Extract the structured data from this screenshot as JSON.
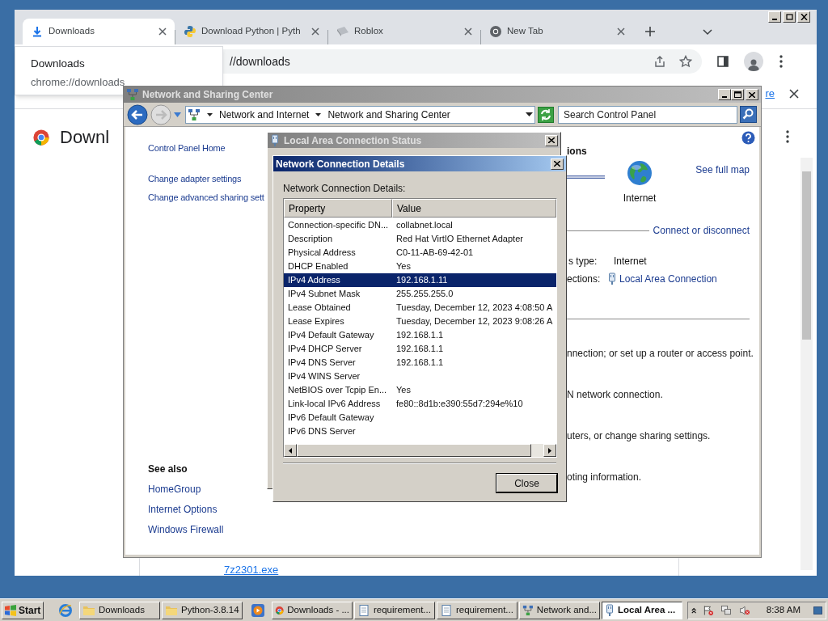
{
  "browser": {
    "tabs": [
      {
        "kind": "download",
        "title": "Downloads",
        "selected": true
      },
      {
        "kind": "python",
        "title": "Download Python | Pyth",
        "selected": false
      },
      {
        "kind": "roblox",
        "title": "Roblox",
        "selected": false
      },
      {
        "kind": "chrome",
        "title": "New Tab",
        "selected": false
      }
    ],
    "address": "//downloads",
    "tooltip": {
      "title": "Downloads",
      "url": "chrome://downloads"
    },
    "infobar": {
      "link": "re"
    },
    "page": {
      "heading": "Downl",
      "file_link": "7z2301.exe"
    }
  },
  "network_center": {
    "title": "Network and Sharing Center",
    "breadcrumb": [
      "Network and Internet",
      "Network and Sharing Center"
    ],
    "search": {
      "placeholder": "Search Control Panel"
    },
    "sidebar": {
      "links": [
        "Control Panel Home",
        "Change adapter settings",
        "Change advanced sharing sett"
      ],
      "see_also_heading": "See also",
      "see_also": [
        "HomeGroup",
        "Internet Options",
        "Windows Firewall"
      ]
    },
    "content": {
      "heading": "ions",
      "map_link": "See full map",
      "internet_label": "Internet",
      "connect_link": "Connect or disconnect",
      "access_type_label": "s type:",
      "access_type": "Internet",
      "connections_label": "ections:",
      "connection_link": "Local Area Connection",
      "tasks": [
        "nnection; or set up a router or access point.",
        "N network connection.",
        "uters, or change sharing settings.",
        "oting information."
      ]
    }
  },
  "status_window": {
    "title": "Local Area Connection Status"
  },
  "details_dialog": {
    "title": "Network Connection Details",
    "label": "Network Connection Details:",
    "columns": [
      "Property",
      "Value"
    ],
    "rows": [
      {
        "property": "Connection-specific DN...",
        "value": "collabnet.local",
        "selected": false
      },
      {
        "property": "Description",
        "value": "Red Hat VirtIO Ethernet Adapter",
        "selected": false
      },
      {
        "property": "Physical Address",
        "value": "C0-11-AB-69-42-01",
        "selected": false
      },
      {
        "property": "DHCP Enabled",
        "value": "Yes",
        "selected": false
      },
      {
        "property": "IPv4 Address",
        "value": "192.168.1.11",
        "selected": true
      },
      {
        "property": "IPv4 Subnet Mask",
        "value": "255.255.255.0",
        "selected": false
      },
      {
        "property": "Lease Obtained",
        "value": "Tuesday, December 12, 2023 4:08:50 A",
        "selected": false
      },
      {
        "property": "Lease Expires",
        "value": "Tuesday, December 12, 2023 9:08:26 A",
        "selected": false
      },
      {
        "property": "IPv4 Default Gateway",
        "value": "192.168.1.1",
        "selected": false
      },
      {
        "property": "IPv4 DHCP Server",
        "value": "192.168.1.1",
        "selected": false
      },
      {
        "property": "IPv4 DNS Server",
        "value": "192.168.1.1",
        "selected": false
      },
      {
        "property": "IPv4 WINS Server",
        "selected": false
      },
      {
        "property": "NetBIOS over Tcpip En...",
        "value": "Yes",
        "selected": false
      },
      {
        "property": "Link-local IPv6 Address",
        "value": "fe80::8d1b:e390:55d7:294e%10",
        "selected": false
      },
      {
        "property": "IPv6 Default Gateway",
        "selected": false
      },
      {
        "property": "IPv6 DNS Server",
        "selected": false
      }
    ],
    "close_button": "Close"
  },
  "taskbar": {
    "start": "Start",
    "items": [
      {
        "kind": "ie"
      },
      {
        "kind": "folder",
        "label": "Downloads",
        "selected": false
      },
      {
        "kind": "folder",
        "label": "Python-3.8.14",
        "selected": false
      },
      {
        "kind": "media"
      },
      {
        "kind": "chrome",
        "label": "Downloads - ...",
        "selected": false
      },
      {
        "kind": "notepad",
        "label": "requirement...",
        "selected": false
      },
      {
        "kind": "notepad",
        "label": "requirement...",
        "selected": false
      },
      {
        "kind": "network",
        "label": "Network and...",
        "selected": false
      },
      {
        "kind": "lan",
        "label": "Local Area ...",
        "selected": true
      }
    ],
    "clock": "8:38 AM"
  }
}
